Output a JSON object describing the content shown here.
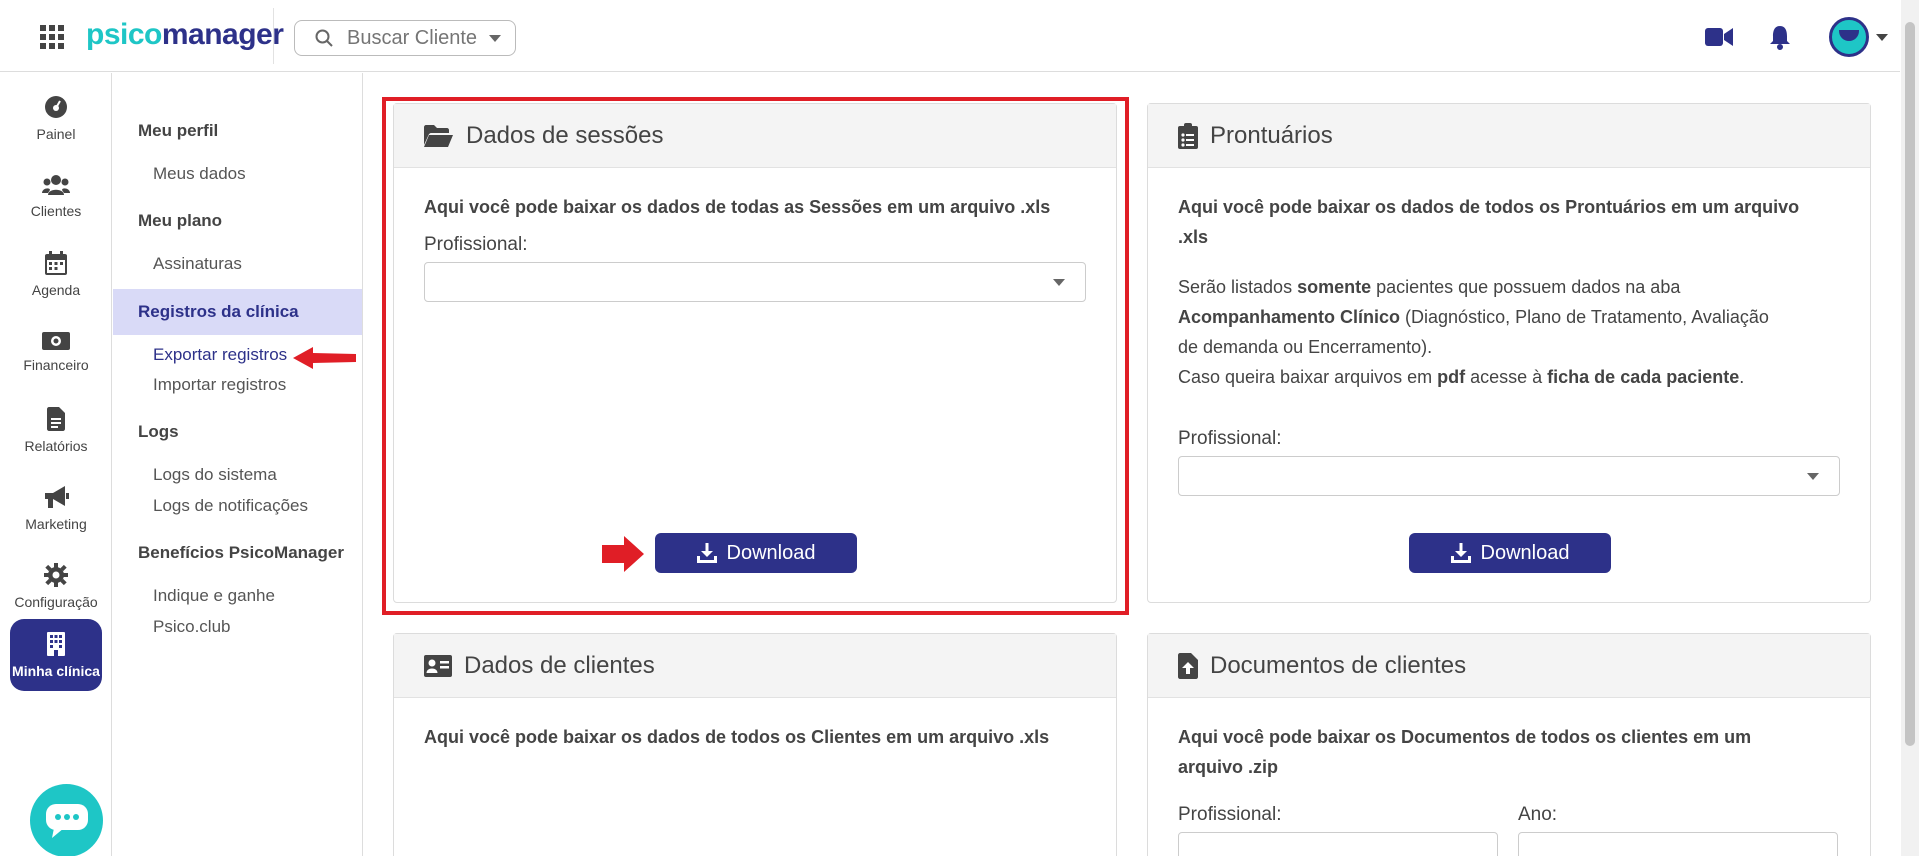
{
  "topbar": {
    "logo_part1": "psico",
    "logo_part2": "manager",
    "search_placeholder": "Buscar Cliente",
    "icons": [
      "apps-grid-icon",
      "video-camera-icon",
      "bell-icon",
      "avatar"
    ]
  },
  "leftnav": {
    "items": [
      {
        "label": "Painel",
        "icon": "dashboard-icon"
      },
      {
        "label": "Clientes",
        "icon": "users-icon"
      },
      {
        "label": "Agenda",
        "icon": "calendar-icon"
      },
      {
        "label": "Financeiro",
        "icon": "money-icon"
      },
      {
        "label": "Relatórios",
        "icon": "report-icon"
      },
      {
        "label": "Marketing",
        "icon": "megaphone-icon"
      },
      {
        "label": "Configuração",
        "icon": "gear-icon"
      },
      {
        "label": "Minha clínica",
        "icon": "building-icon"
      }
    ]
  },
  "submenu": {
    "sections": [
      {
        "heading": "Meu perfil",
        "links": [
          "Meus dados"
        ]
      },
      {
        "heading": "Meu plano",
        "links": [
          "Assinaturas"
        ]
      },
      {
        "heading": "Registros da clínica",
        "links": [
          "Exportar registros",
          "Importar registros"
        ]
      },
      {
        "heading": "Logs",
        "links": [
          "Logs do sistema",
          "Logs de notificações"
        ]
      },
      {
        "heading": "Benefícios PsicoManager",
        "links": [
          "Indique e ganhe",
          "Psico.club"
        ]
      }
    ]
  },
  "cards": {
    "sessoes": {
      "title": "Dados de sessões",
      "description": "Aqui você pode baixar os dados de todas as Sessões em um arquivo .xls",
      "field_label": "Profissional:",
      "button": "Download"
    },
    "prontuarios": {
      "title": "Prontuários",
      "description_line1": "Aqui você pode baixar os dados de todos os Prontuários em um arquivo",
      "description_line2": ".xls",
      "p1_a": "Serão listados ",
      "p1_b": "somente",
      "p1_c": " pacientes que possuem dados na aba",
      "p2_a": "Acompanhamento Clínico",
      "p2_b": " (Diagnóstico, Plano de Tratamento, Avaliação",
      "p3": "de demanda ou Encerramento).",
      "p4_a": "Caso queira baixar arquivos em ",
      "p4_b": "pdf",
      "p4_c": " acesse à ",
      "p4_d": "ficha de cada paciente",
      "p4_e": ".",
      "field_label": "Profissional:",
      "button": "Download"
    },
    "clientes": {
      "title": "Dados de clientes",
      "description": "Aqui você pode baixar os dados de todos os Clientes em um arquivo .xls"
    },
    "documentos": {
      "title": "Documentos de clientes",
      "description_line1": "Aqui você pode baixar os Documentos de todos os clientes em um",
      "description_line2": "arquivo .zip",
      "field_label_1": "Profissional:",
      "field_label_2": "Ano:"
    }
  },
  "colors": {
    "brand_navy": "#2d3189",
    "brand_teal": "#1ec6c6",
    "highlight_red": "#e01e26",
    "active_bg": "#d9daf7"
  }
}
